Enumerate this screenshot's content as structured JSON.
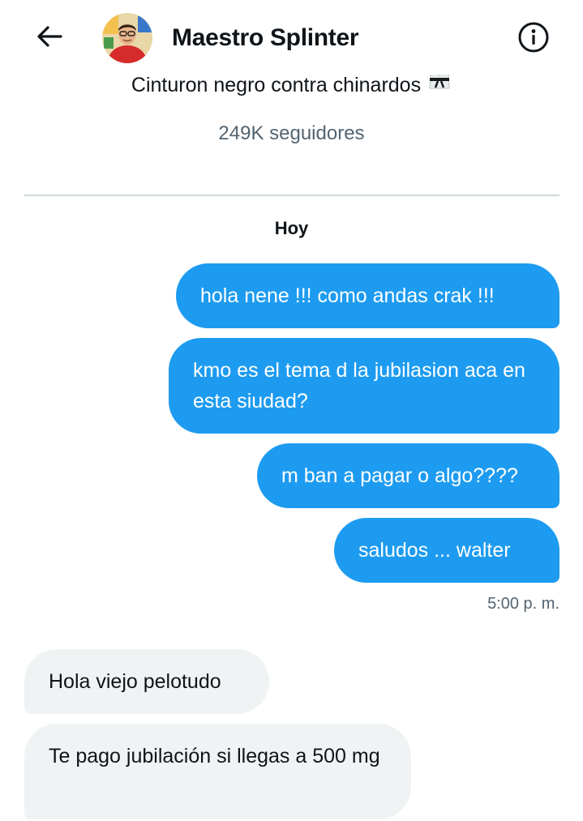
{
  "header": {
    "title": "Maestro Splinter",
    "back_icon": "arrow-left-icon",
    "info_icon": "info-icon"
  },
  "profile": {
    "bio": "Cinturon negro contra chinardos",
    "bio_emoji": "martial-arts-uniform-icon",
    "followers": "249K seguidores"
  },
  "conversation": {
    "day_label": "Hoy",
    "sent_messages": [
      "hola nene !!! como andas crak !!!",
      "kmo es el tema d la jubilasion aca en esta siudad?",
      "m ban a pagar o algo????",
      "saludos ... walter"
    ],
    "sent_timestamp": "5:00 p. m.",
    "received_messages": [
      "Hola viejo pelotudo",
      "Te pago jubilación si llegas a 500 mg"
    ]
  },
  "colors": {
    "accent": "#1d9bf0",
    "received_bubble": "#eff3f4",
    "secondary_text": "#536471",
    "divider": "#cfd9de"
  }
}
